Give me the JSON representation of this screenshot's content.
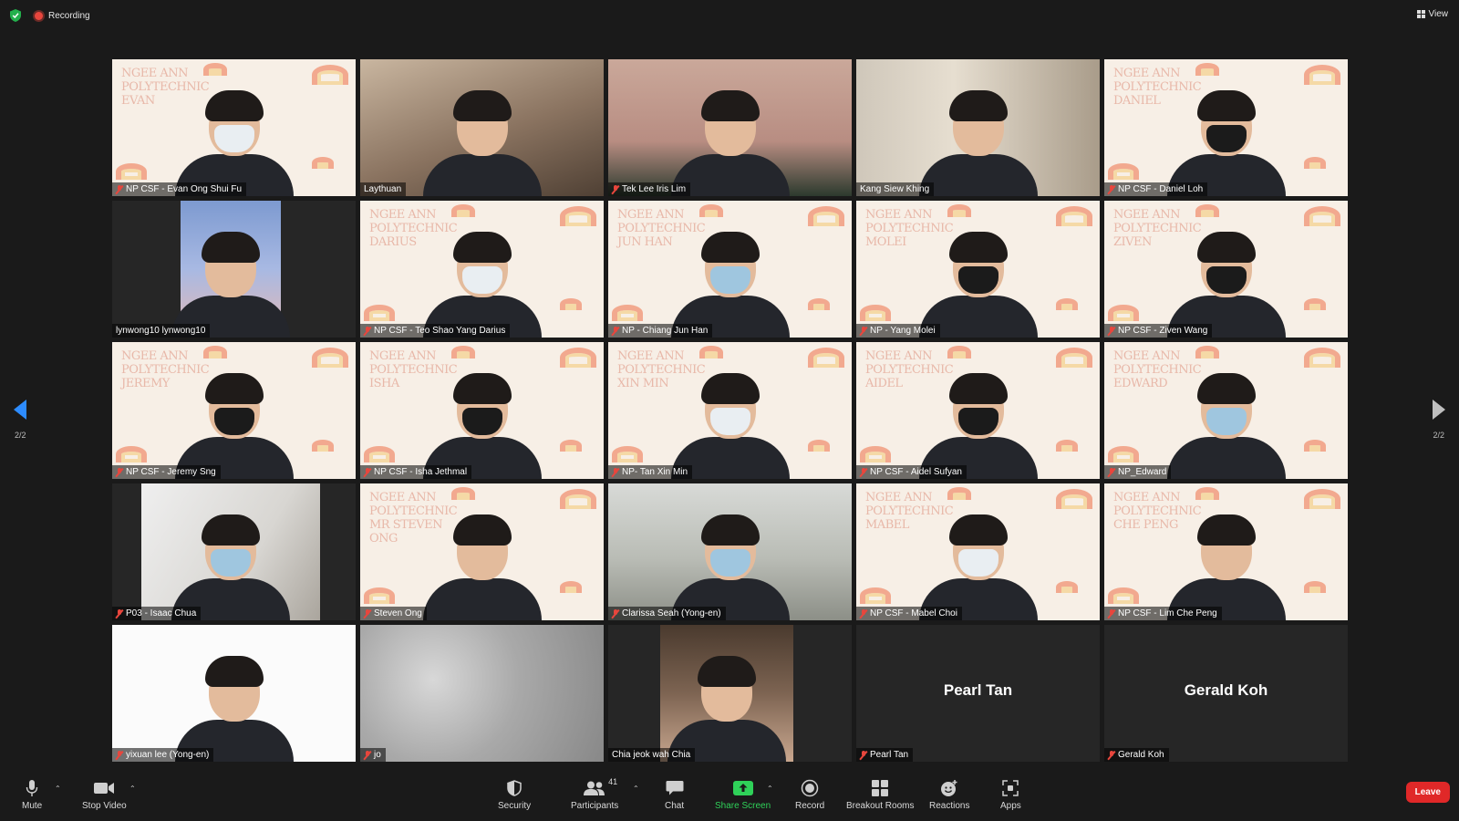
{
  "topbar": {
    "recording_label": "Recording",
    "view_label": "View"
  },
  "pagination": {
    "left_page": "2/2",
    "right_page": "2/2"
  },
  "participants": [
    {
      "name": "NP CSF - Evan Ong Shui Fu",
      "muted": true,
      "bg": "ngee",
      "bg_text": "NGEE ANN\nPOLYTECHNIC\nEVAN",
      "mask": "white"
    },
    {
      "name": "Laythuan",
      "muted": false,
      "bg": "room"
    },
    {
      "name": "Tek Lee Iris Lim",
      "muted": true,
      "bg": "red"
    },
    {
      "name": "Kang Siew Khing",
      "muted": false,
      "bg": "curtain"
    },
    {
      "name": "NP CSF - Daniel Loh",
      "muted": true,
      "bg": "ngee",
      "bg_text": "NGEE ANN\nPOLYTECHNIC\nDANIEL",
      "mask": "black"
    },
    {
      "name": "lynwong10 lynwong10",
      "muted": false,
      "bg": "dark",
      "inner": "sky"
    },
    {
      "name": "NP CSF - Teo Shao Yang Darius",
      "muted": true,
      "bg": "ngee",
      "bg_text": "NGEE ANN\nPOLYTECHNIC\nDARIUS",
      "mask": "white"
    },
    {
      "name": "NP - Chiang Jun Han",
      "muted": true,
      "bg": "ngee",
      "bg_text": "NGEE ANN\nPOLYTECHNIC\nJUN HAN",
      "mask": "blue"
    },
    {
      "name": "NP - Yang Molei",
      "muted": true,
      "bg": "ngee",
      "bg_text": "NGEE ANN\nPOLYTECHNIC\nMOLEI",
      "mask": "black"
    },
    {
      "name": "NP CSF - Ziven Wang",
      "muted": true,
      "bg": "ngee",
      "bg_text": "NGEE ANN\nPOLYTECHNIC\nZIVEN",
      "mask": "black"
    },
    {
      "name": "NP CSF - Jeremy Sng",
      "muted": true,
      "bg": "ngee",
      "bg_text": "NGEE ANN\nPOLYTECHNIC\nJEREMY",
      "mask": "black"
    },
    {
      "name": "NP CSF - Isha Jethmal",
      "muted": true,
      "bg": "ngee",
      "bg_text": "NGEE ANN\nPOLYTECHNIC\nISHA",
      "mask": "black"
    },
    {
      "name": "NP- Tan Xin Min",
      "muted": true,
      "bg": "ngee",
      "bg_text": "NGEE ANN\nPOLYTECHNIC\nXIN MIN",
      "mask": "white"
    },
    {
      "name": "NP CSF - Aidel Sufyan",
      "muted": true,
      "bg": "ngee",
      "bg_text": "NGEE ANN\nPOLYTECHNIC\nAIDEL",
      "mask": "black"
    },
    {
      "name": "NP_Edward",
      "muted": true,
      "bg": "ngee",
      "bg_text": "NGEE ANN\nPOLYTECHNIC\nEDWARD",
      "mask": "blue"
    },
    {
      "name": "P03 - Isaac Chua",
      "muted": true,
      "bg": "dark",
      "inner": "white-room",
      "mask": "blue"
    },
    {
      "name": "Steven Ong",
      "muted": true,
      "bg": "ngee",
      "bg_text": "NGEE ANN\nPOLYTECHNIC\nMR STEVEN\nONG"
    },
    {
      "name": "Clarissa Seah (Yong-en)",
      "muted": true,
      "bg": "office",
      "mask": "blue"
    },
    {
      "name": "NP CSF - Mabel Choi",
      "muted": true,
      "bg": "ngee",
      "bg_text": "NGEE ANN\nPOLYTECHNIC\nMABEL",
      "mask": "white"
    },
    {
      "name": "NP CSF - Lim Che Peng",
      "muted": true,
      "bg": "ngee",
      "bg_text": "NGEE ANN\nPOLYTECHNIC\nCHE PENG"
    },
    {
      "name": "yixuan lee (Yong-en)",
      "muted": true,
      "bg": "white"
    },
    {
      "name": "jo",
      "muted": true,
      "bg": "cloud",
      "no_person": true
    },
    {
      "name": "Chia jeok wah Chia",
      "muted": false,
      "bg": "dark",
      "inner": "party"
    },
    {
      "name": "Pearl Tan",
      "muted": true,
      "bg": "dark",
      "center_name": "Pearl Tan",
      "no_person": true
    },
    {
      "name": "Gerald Koh",
      "muted": true,
      "bg": "dark",
      "center_name": "Gerald Koh",
      "no_person": true
    }
  ],
  "toolbar": {
    "mute": "Mute",
    "stop_video": "Stop Video",
    "security": "Security",
    "participants": "Participants",
    "participants_count": "41",
    "chat": "Chat",
    "share_screen": "Share Screen",
    "record": "Record",
    "breakout_rooms": "Breakout Rooms",
    "reactions": "Reactions",
    "apps": "Apps",
    "leave": "Leave"
  },
  "colors": {
    "share_green": "#2fd159",
    "leave_red": "#e02828",
    "accent_blue": "#2d8cff",
    "muted_red": "#e8463d"
  }
}
